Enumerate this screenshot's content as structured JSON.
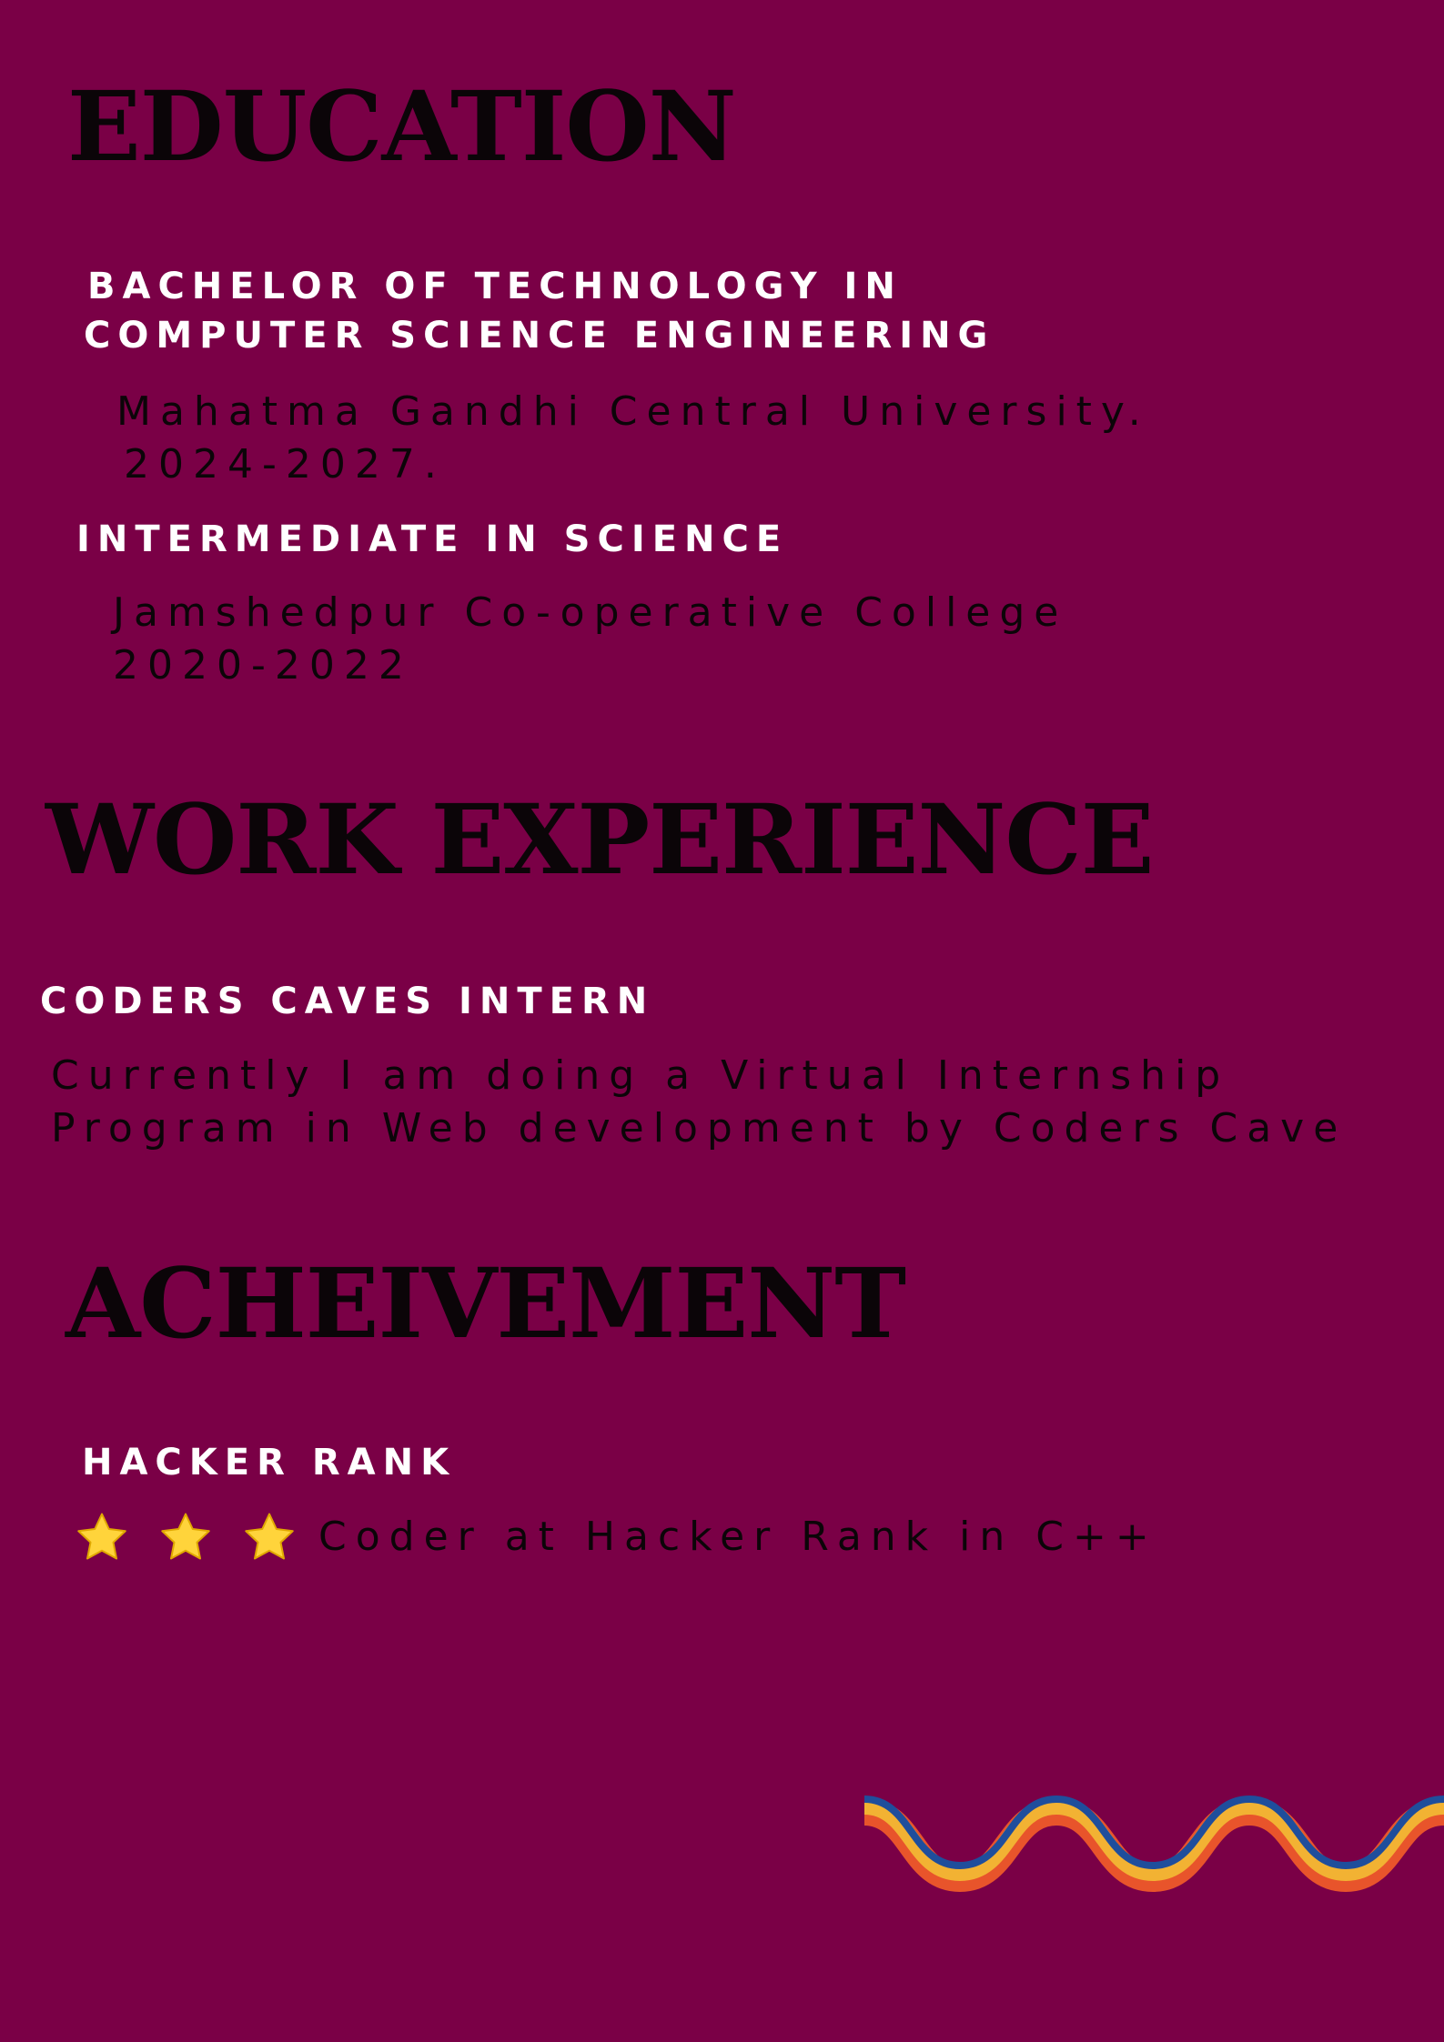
{
  "education": {
    "heading": "EDUCATION",
    "degree": {
      "title_lines": [
        "BACHELOR OF TECHNOLOGY IN",
        "COMPUTER SCIENCE ENGINEERING"
      ],
      "institution": "Mahatma Gandhi  Central University.",
      "years": "2024-2027."
    },
    "intermediate": {
      "title": "INTERMEDIATE IN SCIENCE",
      "institution": "Jamshedpur Co-operative College",
      "years": "2020-2022"
    }
  },
  "work_experience": {
    "heading": "WORK EXPERIENCE",
    "role": "CODERS CAVES INTERN",
    "description_lines": [
      "Currently I am doing a Virtual Internship",
      "Program in Web development by Coders Cave"
    ]
  },
  "achievement": {
    "heading": "ACHEIVEMENT",
    "platform": "HACKER RANK",
    "star_count": 3,
    "description": "Coder at Hacker Rank in C++"
  },
  "colors": {
    "background": "#7a0046",
    "heading": "#0b0508",
    "subheading": "#ffffff",
    "star": "#ffd43b",
    "wave_blue": "#1f4e9c",
    "wave_yellow": "#f2b233",
    "wave_orange": "#e8542b"
  },
  "icons": {
    "star": "star-icon",
    "decoration": "wave-decoration"
  }
}
